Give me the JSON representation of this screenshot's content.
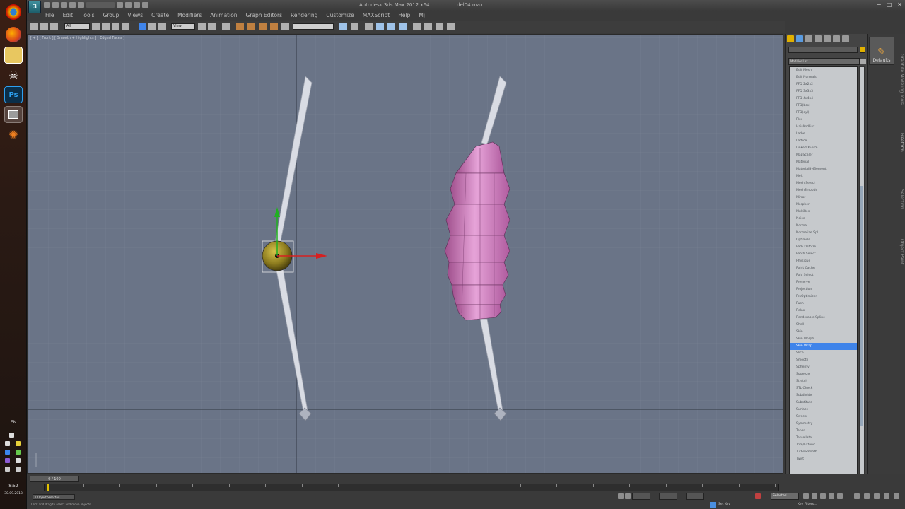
{
  "app": {
    "title": "Autodesk 3ds Max  2012 x64",
    "file": "del04.max",
    "logo": "3"
  },
  "menu": [
    "File",
    "Edit",
    "Tools",
    "Group",
    "Views",
    "Create",
    "Modifiers",
    "Animation",
    "Graph Editors",
    "Rendering",
    "Customize",
    "MAXScript",
    "Help",
    "Mj"
  ],
  "toolbar": {
    "selection_filter": "All",
    "ref_coord": "View"
  },
  "viewport": {
    "label": "[ + ] [ Front ] [ Smooth + Highlights ] [ Edged Faces ]"
  },
  "command_panel": {
    "modifier_list": "Modifier List",
    "items": [
      "Edit Mesh",
      "Edit Normals",
      "FFD 2x2x2",
      "FFD 3x3x3",
      "FFD 4x4x4",
      "FFD(box)",
      "FFD(cyl)",
      "Flex",
      "HairAndFur",
      "Lathe",
      "Lattice",
      "Linked XForm",
      "MapScaler",
      "Material",
      "MaterialByElement",
      "Melt",
      "Mesh Select",
      "MeshSmooth",
      "Mirror",
      "Morpher",
      "MultiRes",
      "Noise",
      "Normal",
      "Normalize Spl.",
      "Optimize",
      "Path Deform",
      "Patch Select",
      "Physique",
      "Point Cache",
      "Poly Select",
      "Preserve",
      "Projection",
      "ProOptimizer",
      "Push",
      "Relax",
      "Renderable Spline",
      "Shell",
      "Skin",
      "Skin Morph",
      "Skin Wrap",
      "Slice",
      "Smooth",
      "Spherify",
      "Squeeze",
      "Stretch",
      "STL Check",
      "Subdivide",
      "Substitute",
      "Surface",
      "Sweep",
      "Symmetry",
      "Taper",
      "Tessellate",
      "Trim/Extend",
      "TurboSmooth",
      "Twist"
    ],
    "selected_index": 39
  },
  "ribbon": {
    "defaults_label": "Defaults",
    "tabs": [
      "Graphite Modeling Tools",
      "Freeform",
      "Selection",
      "Object Paint"
    ]
  },
  "taskbar": {
    "lang": "EN",
    "time": "8:52",
    "date": "30.09.2013"
  },
  "bottom": {
    "frame": "0 / 100",
    "status_main": "1 Object Selected",
    "status_hint": "Click and drag to select and move objects",
    "selection_set": "Selected",
    "set_key": "Set Key",
    "filters": "Key Filters..."
  },
  "colors": {
    "viewport_bg": "#6a7487",
    "bone_fill": "#d9dce4",
    "skin_fill": "#d986c6",
    "helper_fill": "#8c7b1e",
    "accent_sel": "#3f84ea",
    "axis_x": "#d62020",
    "axis_y": "#20b020"
  },
  "icons": [
    "chrome-icon",
    "firefox-icon",
    "explorer-icon",
    "skull-icon",
    "photoshop-icon",
    "3dsmax-icon",
    "fire-icon",
    "search-icon",
    "pin-icon",
    "gear-icon",
    "close-icon",
    "minimize-icon",
    "maximize-icon"
  ]
}
